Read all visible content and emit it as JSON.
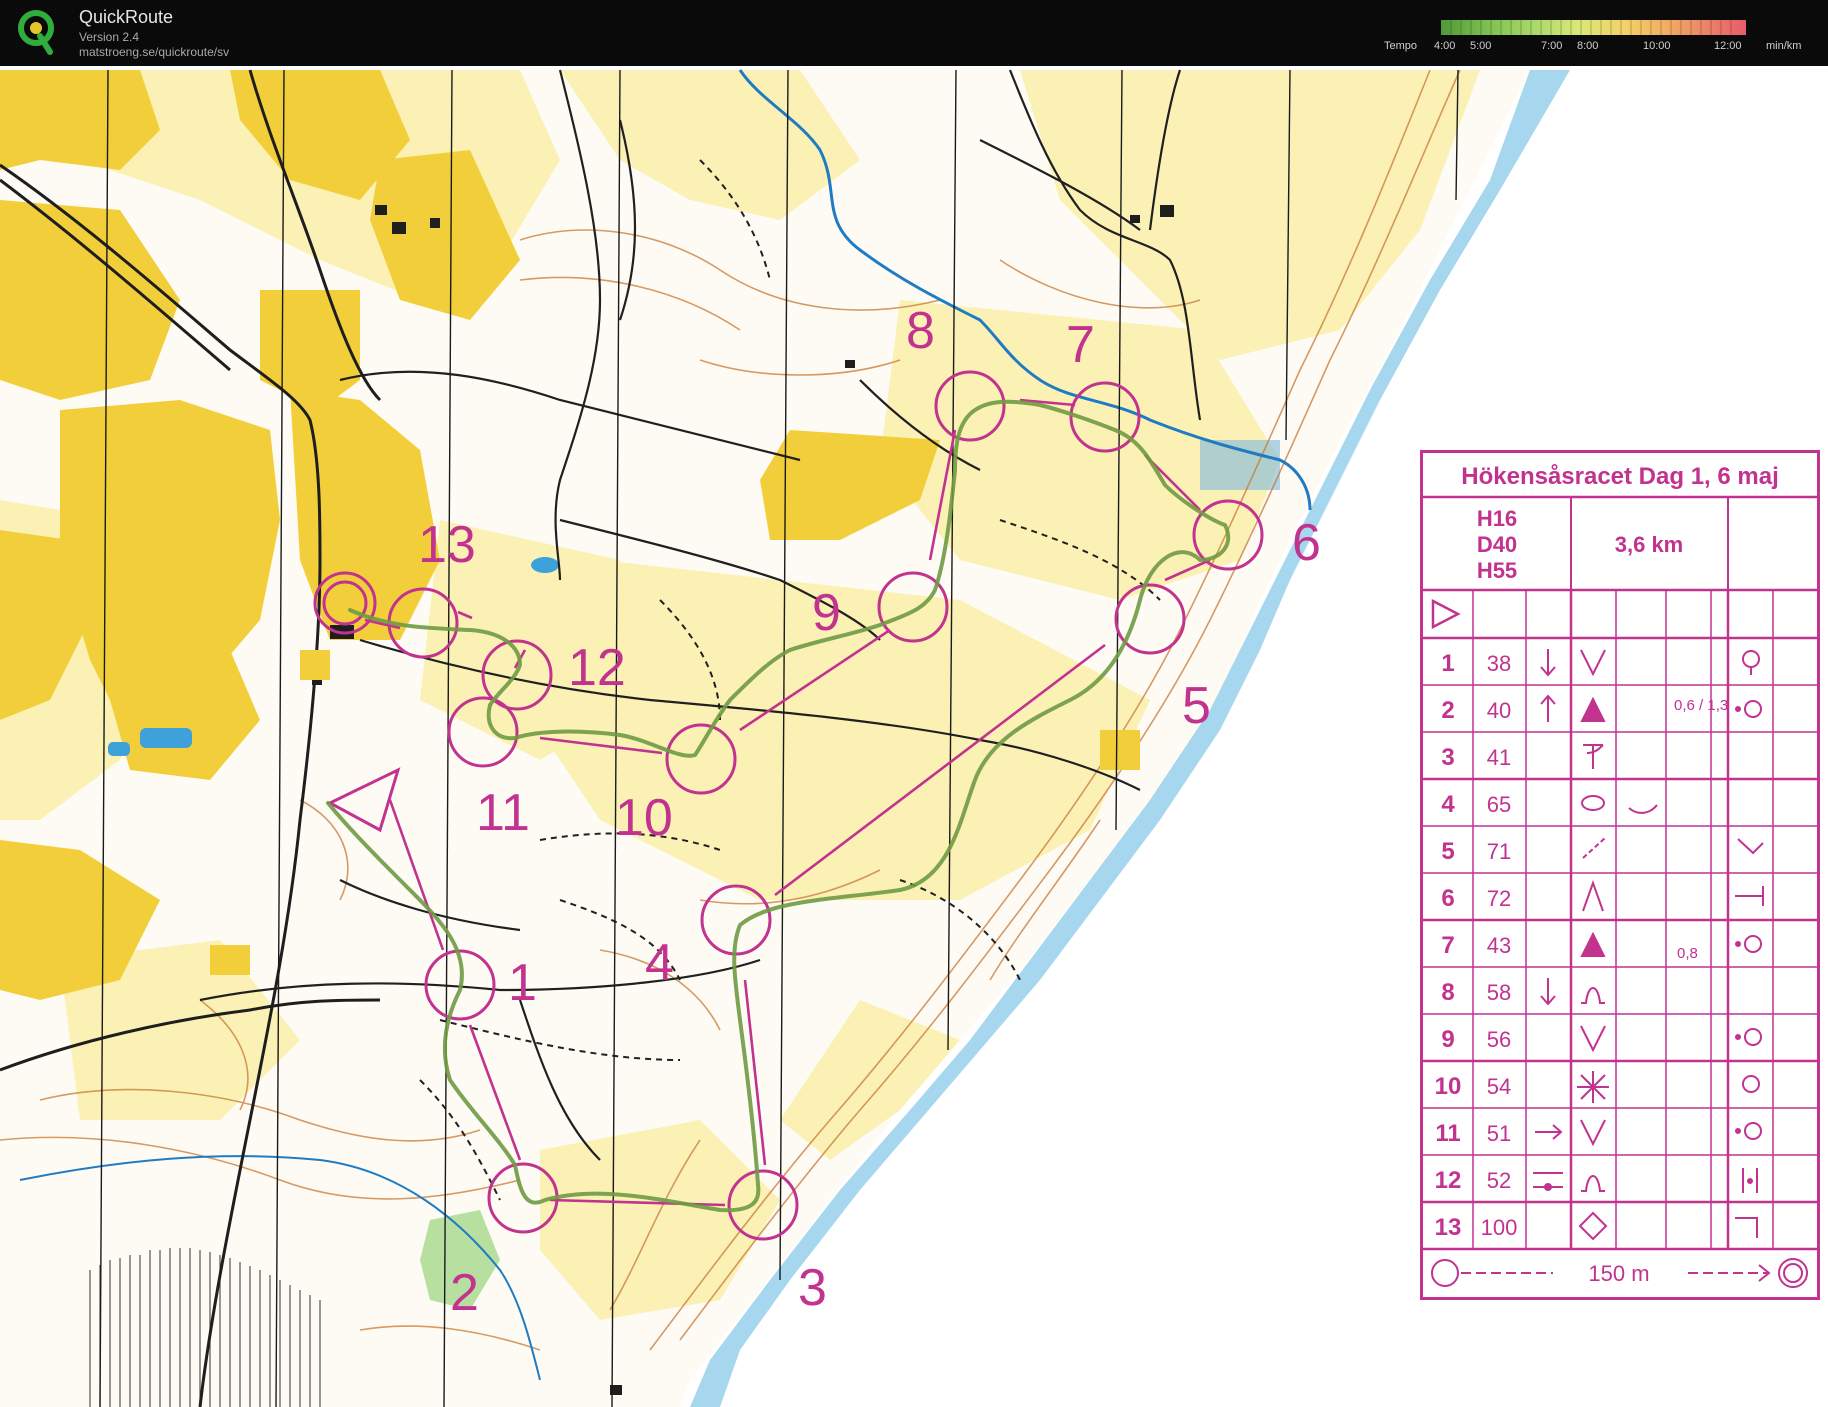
{
  "app": {
    "name": "QuickRoute",
    "version": "Version 2.4",
    "url": "matstroeng.se/quickroute/sv"
  },
  "tempo": {
    "label": "Tempo",
    "ticks": [
      "4:00",
      "5:00",
      "7:00",
      "8:00",
      "10:00",
      "12:00"
    ],
    "unit": "min/km"
  },
  "colors": {
    "course": "#c2328f",
    "route": "#6f9a42",
    "open_land": "#f2cf3a",
    "rough_open": "#fbf1b5",
    "water": "#9fd2ec",
    "contour": "#c97935",
    "path": "#202020",
    "bar_bg": "#0a0a0a"
  },
  "course": {
    "title": "Hökensåsracet Dag 1, 6 maj",
    "classes": [
      "H16",
      "D40",
      "H55"
    ],
    "length": "3,6 km",
    "controls": [
      {
        "n": "1",
        "code": "38",
        "col_c": "down-arrow",
        "col_d": "V",
        "col_g": "",
        "col_h": "circle-open"
      },
      {
        "n": "2",
        "code": "40",
        "col_c": "up-arrow",
        "col_d": "triangle",
        "col_g": "0,6 / 1,3",
        "col_h": "dot-circle"
      },
      {
        "n": "3",
        "code": "41",
        "col_c": "",
        "col_d": "T-shape",
        "col_g": "",
        "col_h": ""
      },
      {
        "n": "4",
        "code": "65",
        "col_c": "",
        "col_d": "ellipse",
        "col_g": "",
        "col_h": ""
      },
      {
        "n": "5",
        "code": "71",
        "col_c": "",
        "col_d": "slash",
        "col_g": "",
        "col_h": "corner"
      },
      {
        "n": "6",
        "code": "72",
        "col_c": "",
        "col_d": "peak",
        "col_g": "",
        "col_h": "T-right"
      },
      {
        "n": "7",
        "code": "43",
        "col_c": "",
        "col_d": "triangle",
        "col_g": "0,8",
        "col_h": "dot-circle"
      },
      {
        "n": "8",
        "code": "58",
        "col_c": "down-arrow",
        "col_d": "arch",
        "col_g": "",
        "col_h": ""
      },
      {
        "n": "9",
        "code": "56",
        "col_c": "",
        "col_d": "V",
        "col_g": "",
        "col_h": "dot-circle"
      },
      {
        "n": "10",
        "code": "54",
        "col_c": "",
        "col_d": "thicket",
        "col_g": "",
        "col_h": "circle-open"
      },
      {
        "n": "11",
        "code": "51",
        "col_c": "right-arrow",
        "col_d": "V",
        "col_g": "",
        "col_h": "dot-circle"
      },
      {
        "n": "12",
        "code": "52",
        "col_c": "between",
        "col_d": "arch",
        "col_g": "",
        "col_h": "bars"
      },
      {
        "n": "13",
        "code": "100",
        "col_c": "",
        "col_d": "diamond",
        "col_g": "",
        "col_h": "corner-down"
      }
    ],
    "finish_distance": "150 m"
  },
  "map_labels": {
    "c1": "1",
    "c2": "2",
    "c3": "3",
    "c4": "4",
    "c5": "5",
    "c6": "6",
    "c7": "7",
    "c8": "8",
    "c9": "9",
    "c10": "10",
    "c11": "11",
    "c12": "12",
    "c13": "13"
  }
}
